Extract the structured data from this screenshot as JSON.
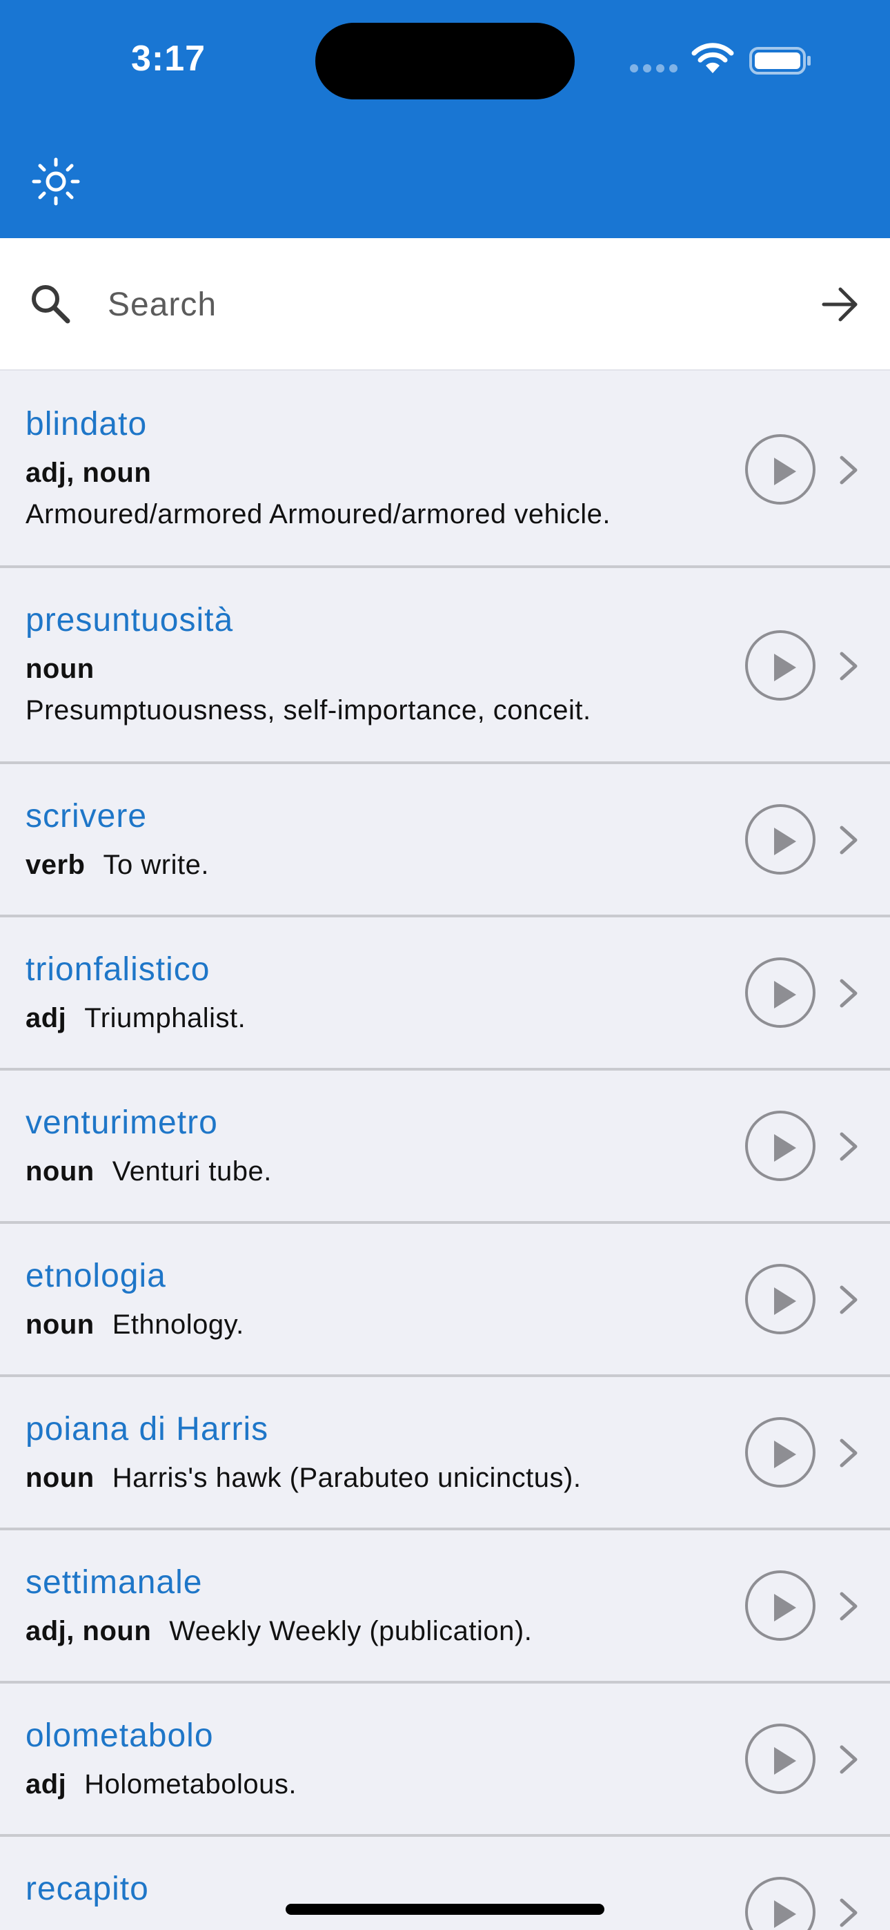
{
  "status_bar": {
    "time": "3:17"
  },
  "search": {
    "placeholder": "Search",
    "value": ""
  },
  "entries": [
    {
      "word": "blindato",
      "pos": "adj, noun",
      "definition": "Armoured/armored Armoured/armored vehicle."
    },
    {
      "word": "presuntuosità",
      "pos": "noun",
      "definition": "Presumptuousness, self-importance, conceit."
    },
    {
      "word": "scrivere",
      "pos": "verb",
      "definition": "To write."
    },
    {
      "word": "trionfalistico",
      "pos": "adj",
      "definition": "Triumphalist."
    },
    {
      "word": "venturimetro",
      "pos": "noun",
      "definition": "Venturi tube."
    },
    {
      "word": "etnologia",
      "pos": "noun",
      "definition": "Ethnology."
    },
    {
      "word": "poiana di Harris",
      "pos": "noun",
      "definition": "Harris's hawk (Parabuteo unicinctus)."
    },
    {
      "word": "settimanale",
      "pos": "adj, noun",
      "definition": "Weekly Weekly (publication)."
    },
    {
      "word": "olometabolo",
      "pos": "adj",
      "definition": "Holometabolous."
    },
    {
      "word": "recapito",
      "pos": "",
      "definition": ""
    }
  ],
  "icons": {
    "theme": "sun-icon",
    "search": "search-icon",
    "submit": "arrow-right-icon",
    "play": "play-circle-icon",
    "disclosure": "chevron-right-icon"
  },
  "colors": {
    "app_bar": "#1976d3",
    "word_link": "#1e76c8",
    "list_background": "#eff0f6"
  }
}
